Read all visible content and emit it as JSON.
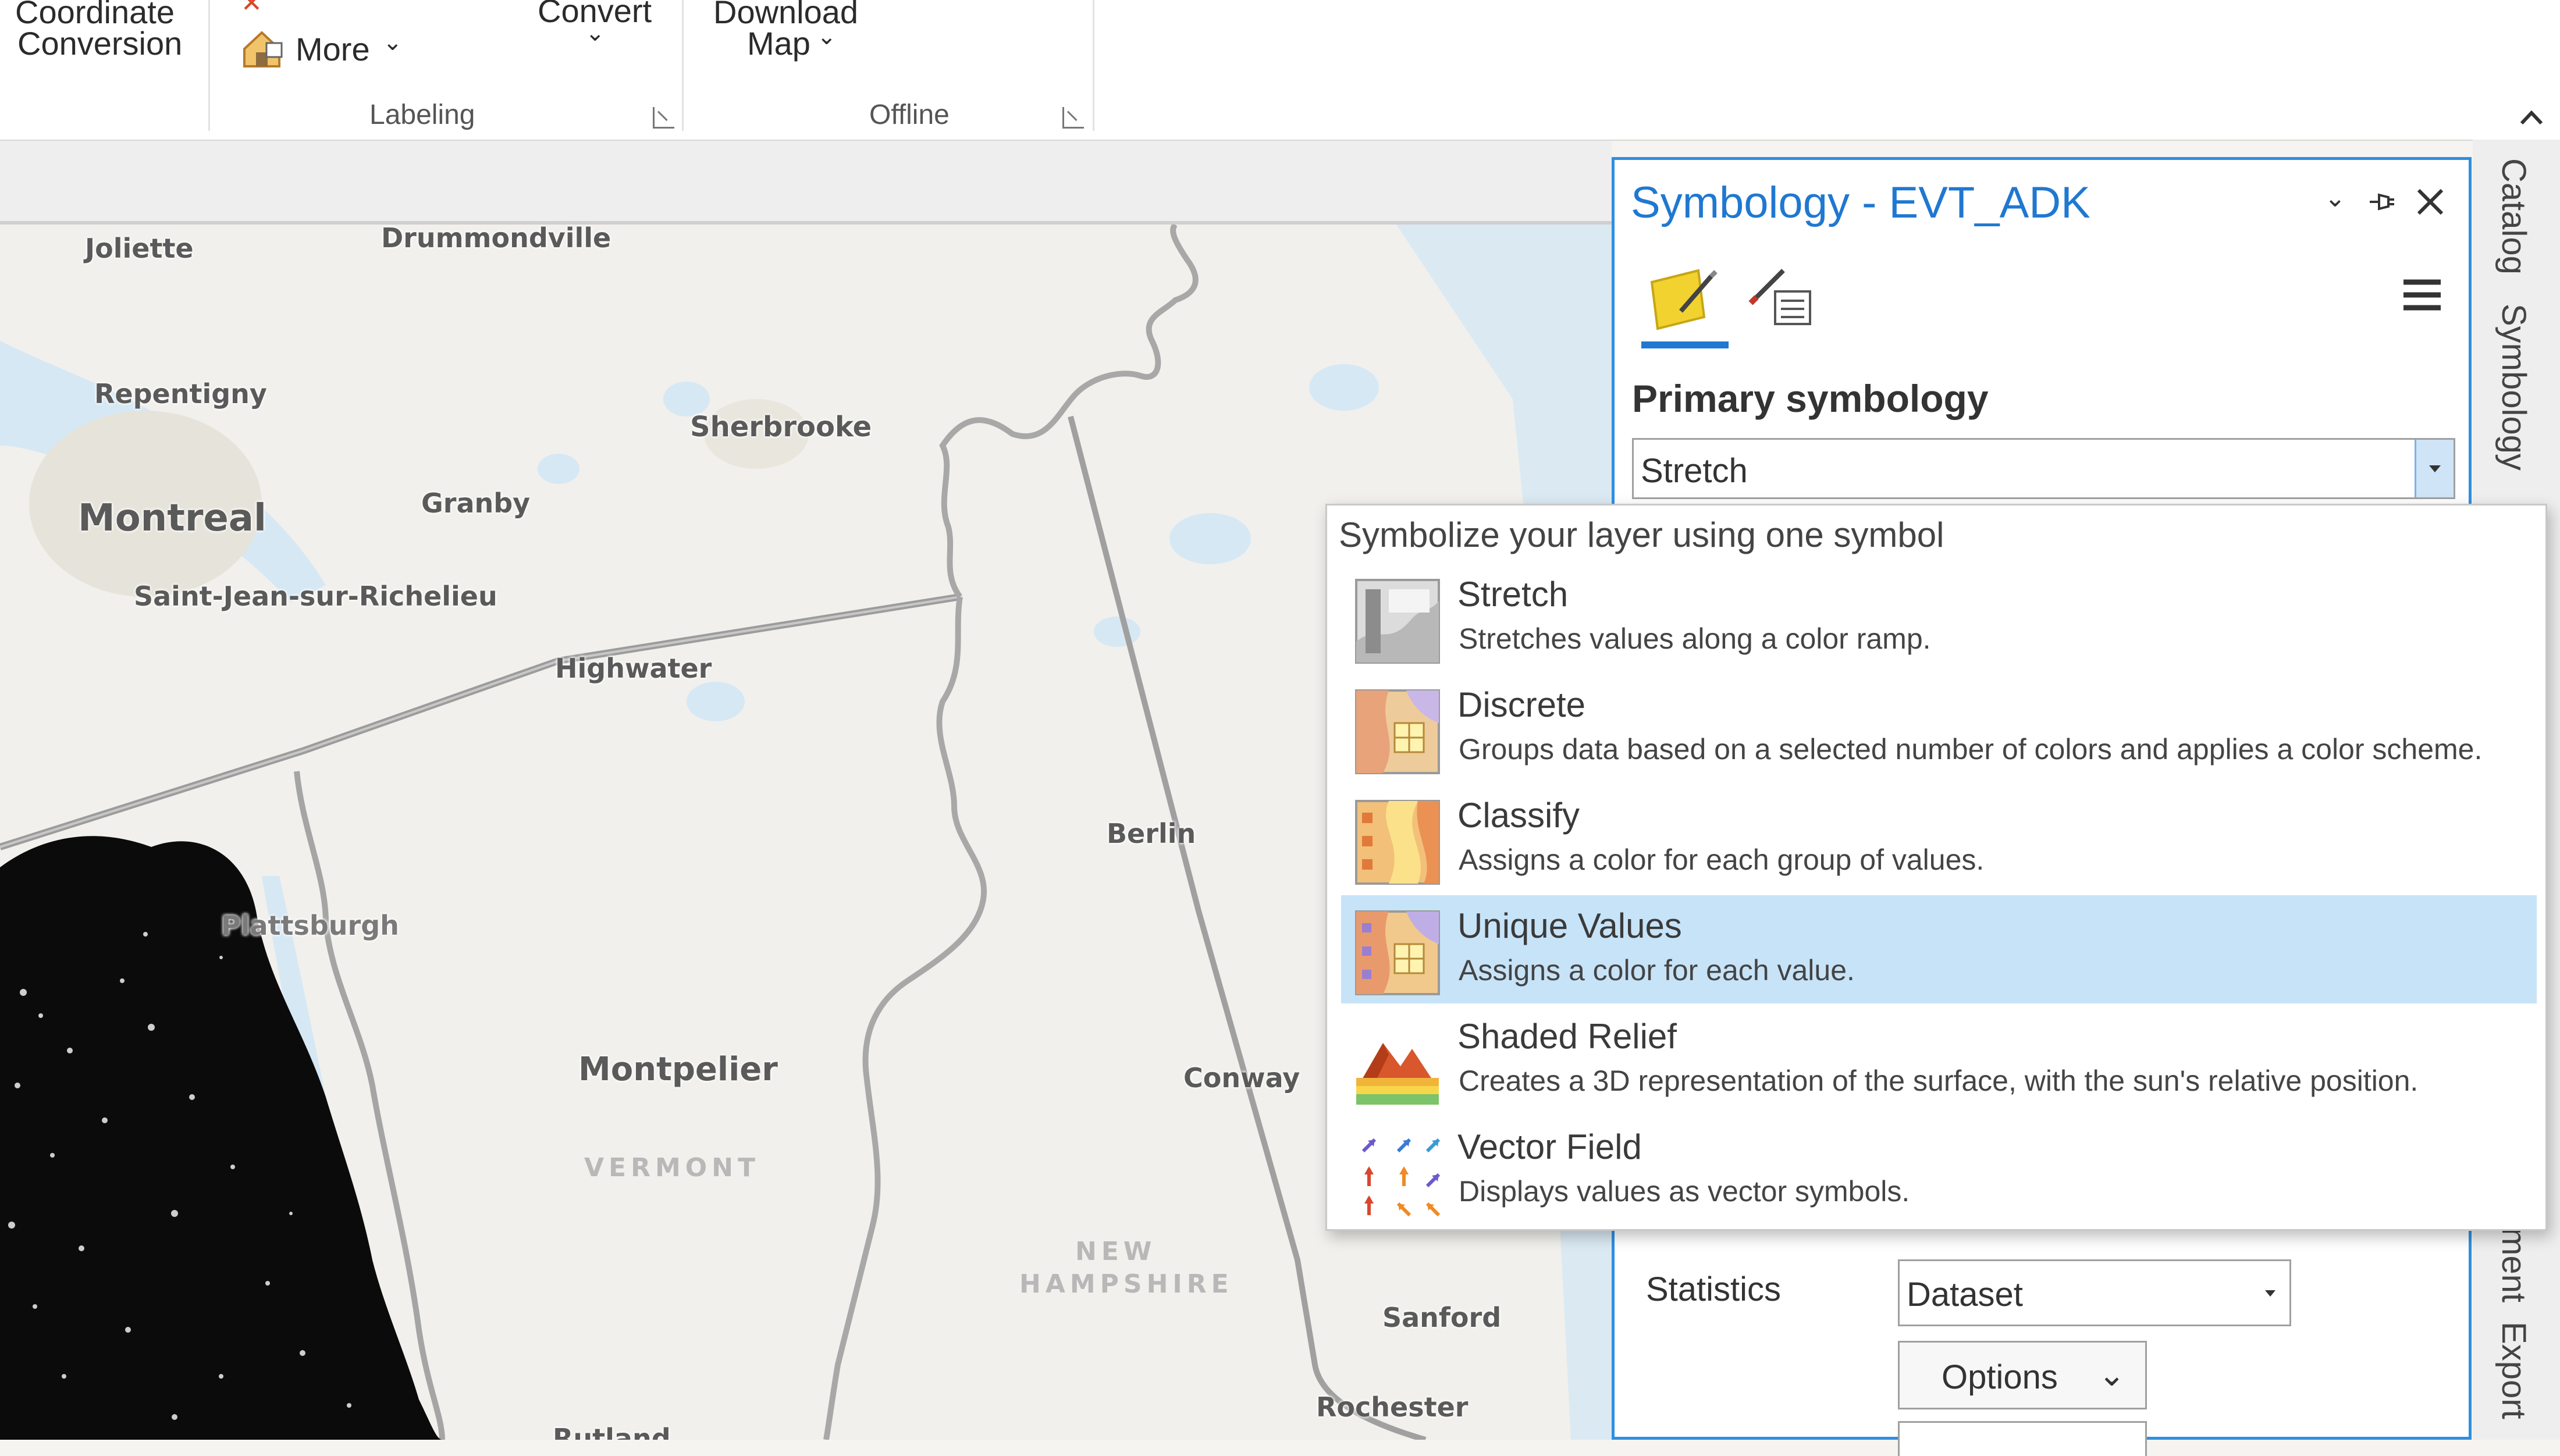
{
  "ribbon": {
    "coordinate_conversion_line1": "Coordinate",
    "coordinate_conversion_line2": "Conversion",
    "more_label": "More",
    "convert_label": "Convert",
    "download_map_line1": "Download",
    "download_map_line2": "Map",
    "group_labeling": "Labeling",
    "group_offline": "Offline"
  },
  "map": {
    "labels": {
      "joliette": "Joliette",
      "drummondville": "Drummondville",
      "repentigny": "Repentigny",
      "sherbrooke": "Sherbrooke",
      "granby": "Granby",
      "montreal": "Montreal",
      "saint_jean": "Saint-Jean-sur-Richelieu",
      "highwater": "Highwater",
      "berlin": "Berlin",
      "plattsburgh": "Plattsburgh",
      "montpelier": "Montpelier",
      "conway": "Conway",
      "vermont": "VERMONT",
      "new_hampshire_1": "NEW",
      "new_hampshire_2": "HAMPSHIRE",
      "sanford": "Sanford",
      "rochester": "Rochester",
      "rutland": "Rutland"
    }
  },
  "pane": {
    "title": "Symbology - EVT_ADK",
    "primary_label": "Primary symbology",
    "renderer_value": "Stretch",
    "statistics_label": "Statistics",
    "statistics_value": "Dataset",
    "options_label": "Options"
  },
  "side_tabs": {
    "catalog": "Catalog",
    "symbology": "Symbology",
    "element_partial": "ment",
    "export": "Export"
  },
  "dropdown": {
    "header": "Symbolize your layer using one symbol",
    "items": [
      {
        "title": "Stretch",
        "desc": "Stretches values along a color ramp.",
        "icon": "stretch-icon"
      },
      {
        "title": "Discrete",
        "desc": "Groups data based on a selected number of colors and applies a color scheme.",
        "icon": "discrete-icon"
      },
      {
        "title": "Classify",
        "desc": "Assigns a color for each group of values.",
        "icon": "classify-icon"
      },
      {
        "title": "Unique Values",
        "desc": "Assigns a color for each value.",
        "icon": "unique-values-icon"
      },
      {
        "title": "Shaded Relief",
        "desc": "Creates a 3D representation of the surface, with the sun's relative position.",
        "icon": "shaded-relief-icon"
      },
      {
        "title": "Vector Field",
        "desc": "Displays values as vector symbols.",
        "icon": "vector-field-icon"
      }
    ],
    "selected": "Unique Values"
  },
  "colors": {
    "accent": "#1f78d1",
    "selected_row": "#c7e3f8",
    "map_background": "#f1f0ec",
    "water": "#d3e6f4"
  }
}
